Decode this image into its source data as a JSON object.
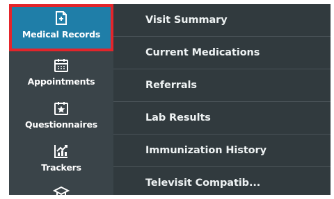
{
  "sidebar": {
    "items": [
      {
        "label": "Medical Records",
        "icon": "medical-records-icon",
        "active": true
      },
      {
        "label": "Appointments",
        "icon": "calendar-icon",
        "active": false
      },
      {
        "label": "Questionnaires",
        "icon": "questionnaire-icon",
        "active": false
      },
      {
        "label": "Trackers",
        "icon": "chart-tracker-icon",
        "active": false
      },
      {
        "label": "",
        "icon": "graduation-cap-icon",
        "active": false
      }
    ]
  },
  "submenu": {
    "items": [
      {
        "label": "Visit Summary"
      },
      {
        "label": "Current Medications"
      },
      {
        "label": "Referrals"
      },
      {
        "label": "Lab Results"
      },
      {
        "label": "Immunization History"
      },
      {
        "label": "Televisit Compatib..."
      }
    ]
  },
  "colors": {
    "sidebar_bg": "#3a4449",
    "submenu_bg": "#313a3e",
    "active_bg": "#1f7ea8",
    "highlight_border": "#e3252b",
    "text": "#ffffff"
  }
}
